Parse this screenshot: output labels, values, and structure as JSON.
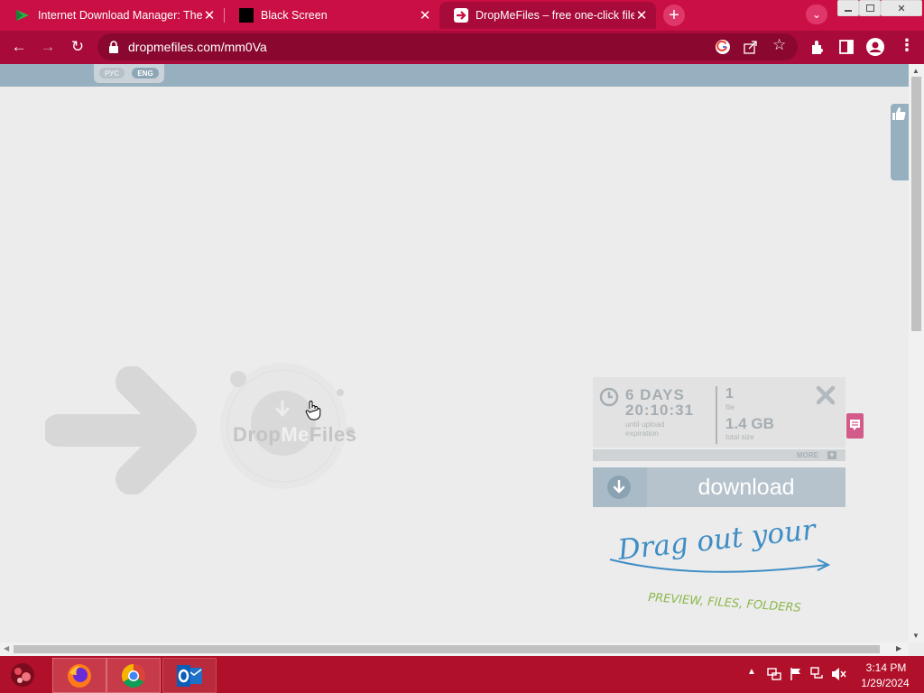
{
  "browser": {
    "tabs": [
      {
        "title": "Internet Download Manager: The",
        "active": false
      },
      {
        "title": "Black Screen",
        "active": false
      },
      {
        "title": "DropMeFiles – free one-click file",
        "active": true
      }
    ],
    "new_tab_label": "+",
    "url": "dropmefiles.com/mm0Va",
    "accent_color": "#c90f43"
  },
  "page": {
    "languages": [
      "РУС",
      "ENG"
    ],
    "brand": {
      "drop": "Drop",
      "me": "Me",
      "files": "Files"
    },
    "expiration": {
      "days": "6 DAYS",
      "time": "20:10:31",
      "note": "until upload expiration"
    },
    "files": {
      "count": "1",
      "count_label": "file",
      "size": "1.4 GB",
      "size_label": "total size"
    },
    "more_label": "MORE",
    "download_label": "download",
    "drag_hint": {
      "line1": "Drag out your",
      "line2": "PREVIEW, FILES, FOLDERS"
    }
  },
  "taskbar": {
    "apps": [
      "firefox",
      "chrome",
      "outlook"
    ],
    "time": "3:14 PM",
    "date": "1/29/2024"
  }
}
